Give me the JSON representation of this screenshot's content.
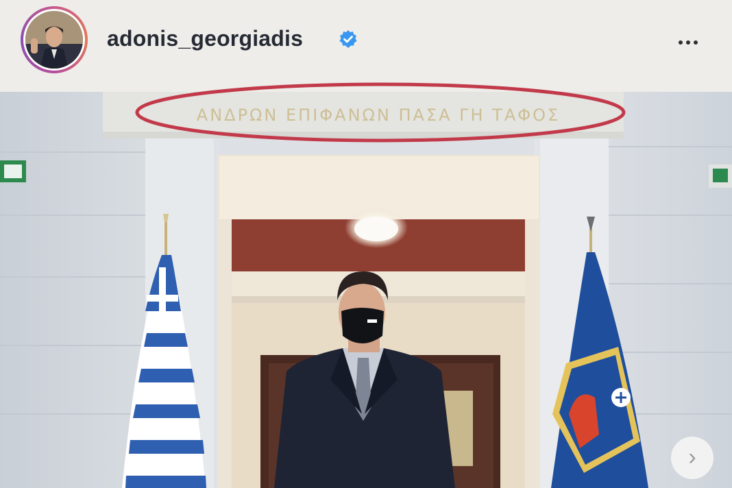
{
  "post": {
    "username": "adonis_georgiadis",
    "verified": true,
    "icons": {
      "verified": "verified-badge-icon",
      "more": "more-options-icon",
      "next": "chevron-right-icon"
    },
    "colors": {
      "verified_blue": "#3897f0",
      "annotation_red": "#c23a4a"
    }
  },
  "photo": {
    "inscription": "ΑΝΔΡΩΝ ΕΠΙΦΑΝΩΝ ΠΑΣΑ ΓΗ ΤΑΦΟΣ"
  }
}
